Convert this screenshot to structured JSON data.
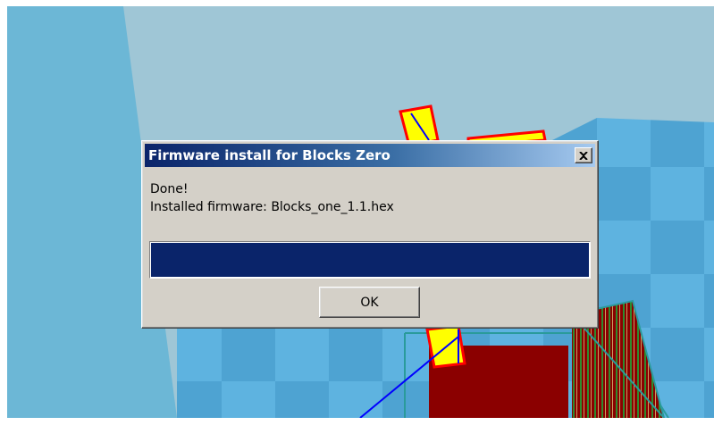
{
  "dialog": {
    "title": "Firmware install for Blocks Zero",
    "close_symbol": "✕",
    "message_line1": "Done!",
    "message_line2": "Installed firmware: Blocks_one_1.1.hex",
    "progress_fraction": 1.0,
    "ok_label": "OK"
  },
  "colors": {
    "title_bar_start": "#0a246a",
    "title_bar_end": "#a6caf0",
    "progress_fill": "#0a246a",
    "dialog_face": "#d4d0c8",
    "viewport_background": "#9fc6d6",
    "grid_light": "#5eb3e0",
    "grid_dark": "#4ea3d2",
    "part_red": "#8b0000",
    "part_yellow": "#ffff00"
  }
}
